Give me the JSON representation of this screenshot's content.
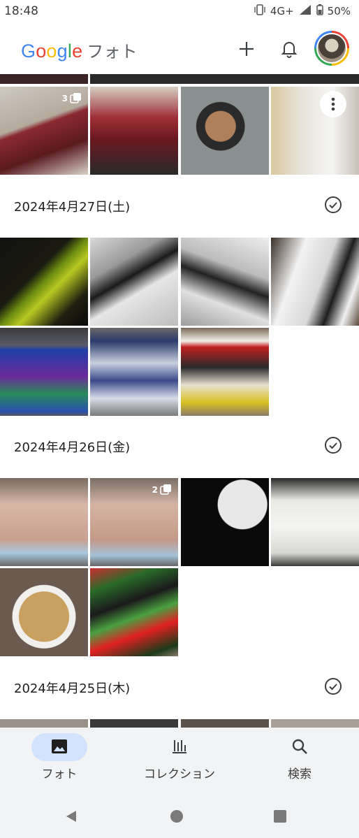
{
  "status_bar": {
    "time": "18:48",
    "network": "4G+",
    "battery": "50%"
  },
  "app": {
    "brand": "Google",
    "product": "フォト"
  },
  "sections": [
    {
      "date": "2024年4月27日(土)"
    },
    {
      "date": "2024年4月26日(金)"
    },
    {
      "date": "2024年4月25日(木)"
    }
  ],
  "badges": {
    "top_stack": "3",
    "apr26_stack": "2"
  },
  "nav": {
    "photos_label": "フォト",
    "collections_label": "コレクション",
    "search_label": "検索"
  },
  "colors": {
    "accent": "#1a73e8",
    "nav_active_pill": "#d3e3fd",
    "nav_bg": "#f1f3f4"
  }
}
